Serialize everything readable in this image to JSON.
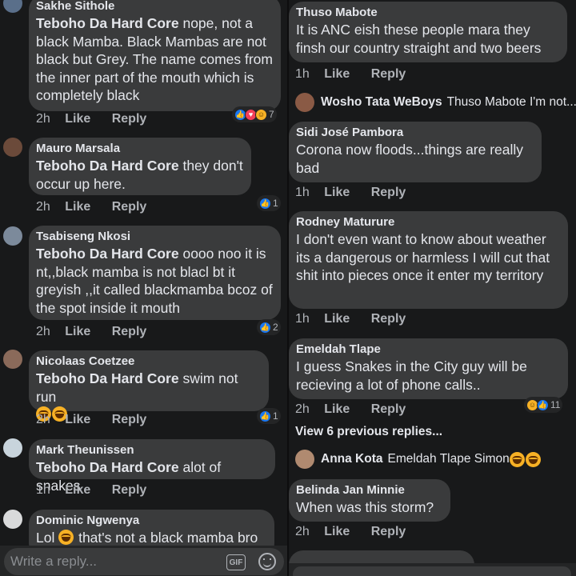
{
  "left": {
    "comments": [
      {
        "name": "Sakhe Sithole",
        "tag": "Teboho Da Hard Core",
        "text": " nope, not a black Mamba. Black Mambas are not black but Grey. The name comes from the inner part of the mouth which is completely black",
        "time": "2h",
        "like": "Like",
        "reply": "Reply",
        "reaction_count": "7"
      },
      {
        "name": "Mauro Marsala",
        "tag": "Teboho Da Hard Core",
        "text": " they don't occur up here.",
        "time": "2h",
        "like": "Like",
        "reply": "Reply",
        "reaction_count": "1"
      },
      {
        "name": "Tsabiseng Nkosi",
        "tag": "Teboho Da Hard Core",
        "text": "  oooo noo it is nt,,black mamba is not blacl bt it greyish ,,it called blackmamba bcoz of the spot inside it mouth",
        "time": "2h",
        "like": "Like",
        "reply": "Reply",
        "reaction_count": "2"
      },
      {
        "name": "Nicolaas Coetzee",
        "tag": "Teboho Da Hard Core",
        "text": " swim not run",
        "time": "2h",
        "like": "Like",
        "reply": "Reply",
        "reaction_count": "1"
      },
      {
        "name": "Mark Theunissen",
        "tag": "Teboho Da Hard Core",
        "text": " alot of snakes",
        "time": "1h",
        "like": "Like",
        "reply": "Reply"
      },
      {
        "name": "Dominic Ngwenya",
        "text_before": "Lol ",
        "text_after": " that's not a black mamba bro"
      }
    ],
    "input_placeholder": "Write a reply...",
    "gif_label": "GIF"
  },
  "right": {
    "comments": [
      {
        "name": "Thuso Mabote",
        "text": "It is ANC eish these people mara they finsh our country straight and two beers",
        "time": "1h",
        "like": "Like",
        "reply": "Reply"
      },
      {
        "name": "Sidi José Pambora",
        "text": "Corona now floods...things are really bad",
        "time": "1h",
        "like": "Like",
        "reply": "Reply"
      },
      {
        "name": "Rodney Maturure",
        "text": "I don't even want to know about weather its a dangerous or harmless I will cut that shit into pieces once it enter my territory",
        "time": "1h",
        "like": "Like",
        "reply": "Reply"
      },
      {
        "name": "Emeldah Tlape",
        "text": "I guess Snakes in the City guy will be recieving a lot of phone calls..",
        "time": "2h",
        "like": "Like",
        "reply": "Reply",
        "reaction_count": "11"
      },
      {
        "name": "Belinda Jan Minnie",
        "text": "When was this storm?",
        "time": "2h",
        "like": "Like",
        "reply": "Reply"
      }
    ],
    "reply_wosho": {
      "name": "Wosho Tata WeBoys",
      "text": "Thuso Mabote I'm not..."
    },
    "view_previous": "View 6 previous replies...",
    "reply_anna": {
      "name": "Anna Kota",
      "text": "Emeldah Tlape Simon "
    }
  }
}
